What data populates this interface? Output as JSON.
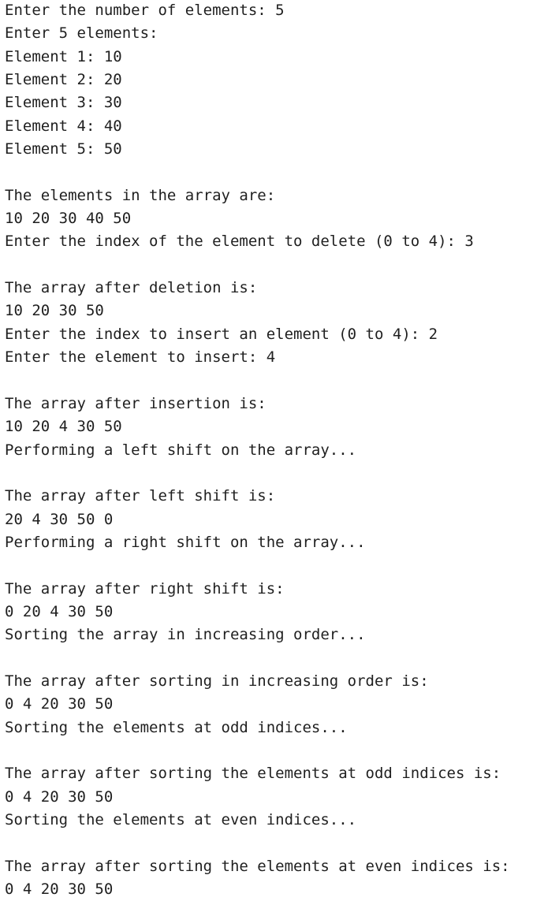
{
  "console": {
    "lines": [
      "Enter the number of elements: 5",
      "Enter 5 elements:",
      "Element 1: 10",
      "Element 2: 20",
      "Element 3: 30",
      "Element 4: 40",
      "Element 5: 50",
      "",
      "The elements in the array are:",
      "10 20 30 40 50",
      "Enter the index of the element to delete (0 to 4): 3",
      "",
      "The array after deletion is:",
      "10 20 30 50",
      "Enter the index to insert an element (0 to 4): 2",
      "Enter the element to insert: 4",
      "",
      "The array after insertion is:",
      "10 20 4 30 50",
      "Performing a left shift on the array...",
      "",
      "The array after left shift is:",
      "20 4 30 50 0",
      "Performing a right shift on the array...",
      "",
      "The array after right shift is:",
      "0 20 4 30 50",
      "Sorting the array in increasing order...",
      "",
      "The array after sorting in increasing order is:",
      "0 4 20 30 50",
      "Sorting the elements at odd indices...",
      "",
      "The array after sorting the elements at odd indices is:",
      "0 4 20 30 50",
      "Sorting the elements at even indices...",
      "",
      "The array after sorting the elements at even indices is:",
      "0 4 20 30 50"
    ]
  }
}
